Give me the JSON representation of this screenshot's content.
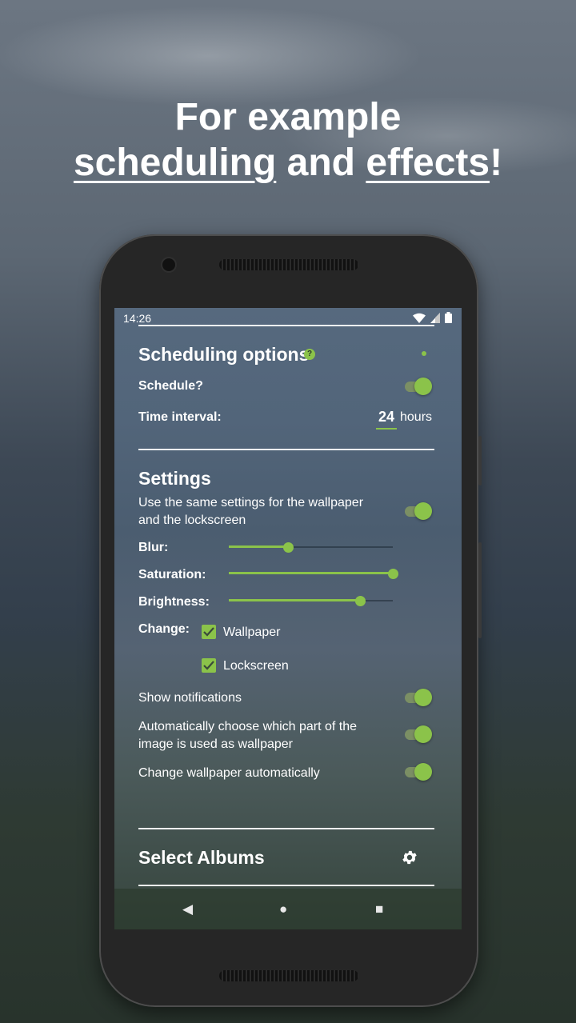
{
  "headline": {
    "line1": "For example",
    "line2_word1": "scheduling",
    "line2_word2": " and ",
    "line2_word3": "effects",
    "line2_end": "!"
  },
  "status_bar": {
    "time": "14:26",
    "icons": [
      "wifi-icon",
      "signal-icon",
      "battery-icon"
    ]
  },
  "scheduling": {
    "title": "Scheduling options",
    "help_glyph": "?",
    "schedule_label": "Schedule?",
    "schedule_on": true,
    "interval_label": "Time interval:",
    "interval_value": "24",
    "interval_unit": "hours"
  },
  "settings": {
    "title": "Settings",
    "same_settings_line1": "Use the same settings for the wallpaper",
    "same_settings_line2": "and the lockscreen",
    "same_settings_on": true,
    "blur_label": "Blur:",
    "blur_level": 0.36,
    "saturation_label": "Saturation:",
    "saturation_level": 1.0,
    "brightness_label": "Brightness:",
    "brightness_level": 0.8,
    "change_label": "Change:",
    "wallpaper_label": "Wallpaper",
    "wallpaper_checked": true,
    "lockscreen_label": "Lockscreen",
    "lockscreen_checked": true,
    "notifications_label": "Show notifications",
    "notifications_on": true,
    "autopart_line1": "Automatically choose which part of the",
    "autopart_line2": "image is used as wallpaper",
    "autopart_on": true,
    "autochange_label": "Change wallpaper automatically",
    "autochange_on": true
  },
  "albums": {
    "title": "Select Albums",
    "icon": "gear-icon"
  },
  "nav": {
    "back": "◀",
    "home": "●",
    "recents": "■"
  },
  "colors": {
    "accent": "#8bc34a",
    "text": "#ffffff"
  }
}
